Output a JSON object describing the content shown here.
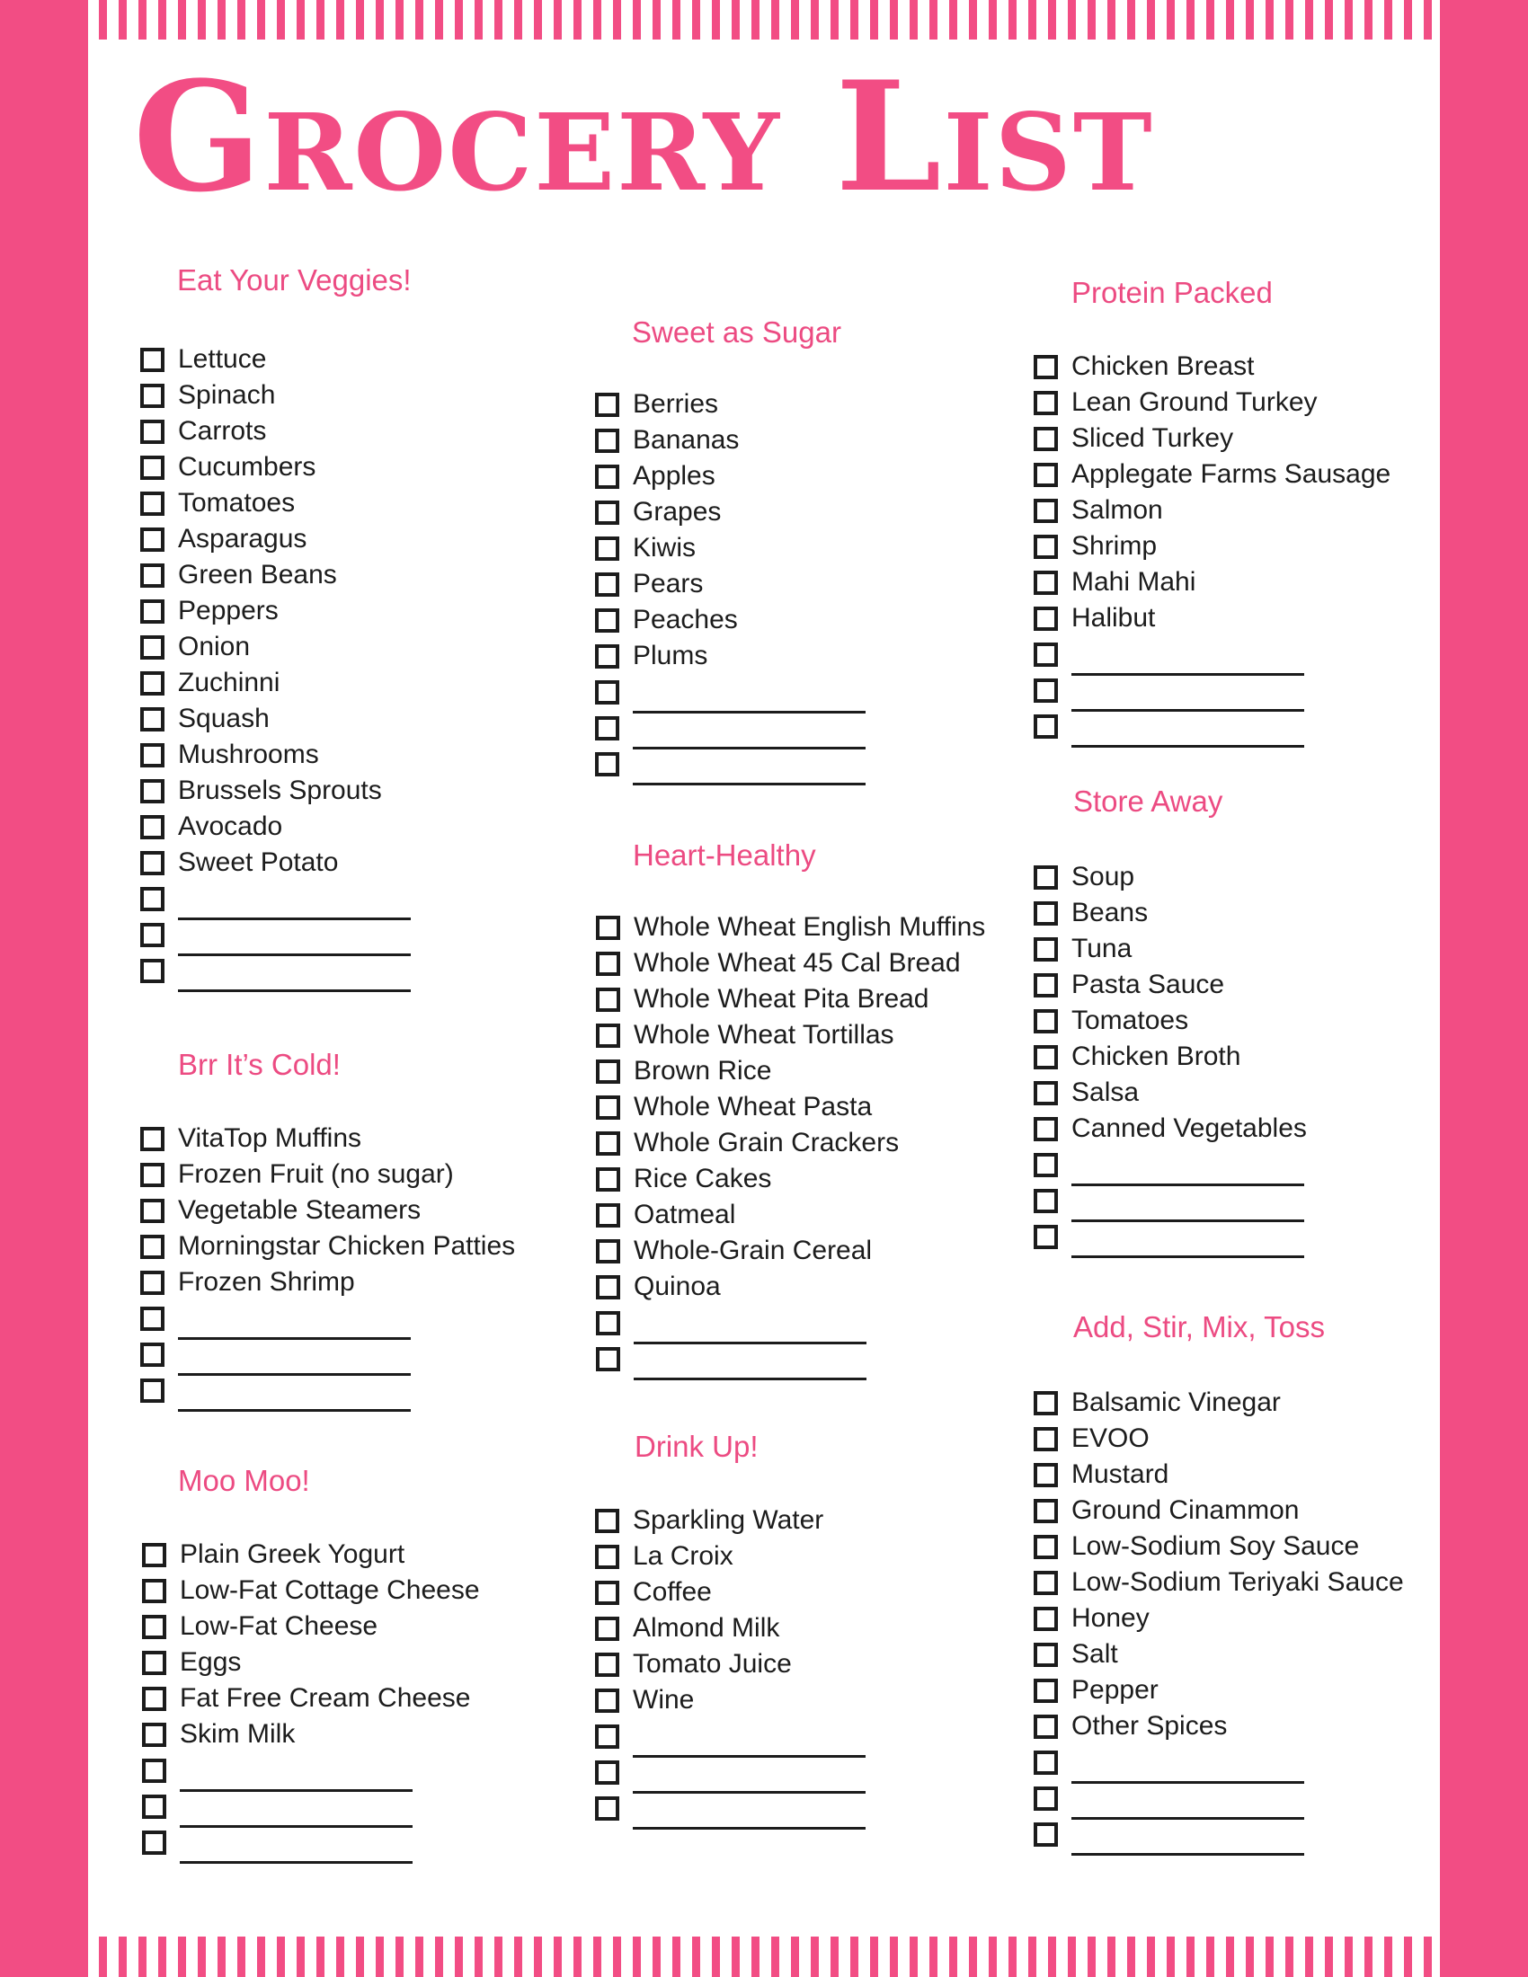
{
  "title": "Grocery List",
  "colors": {
    "accent": "#f24d84",
    "heading": "#ec4b82",
    "text": "#1c1c1c"
  },
  "sections": {
    "veggies": {
      "title": "Eat Your Veggies!",
      "items": [
        "Lettuce",
        "Spinach",
        "Carrots",
        "Cucumbers",
        "Tomatoes",
        "Asparagus",
        "Green Beans",
        "Peppers",
        "Onion",
        "Zuchinni",
        "Squash",
        "Mushrooms",
        "Brussels Sprouts",
        "Avocado",
        "Sweet Potato"
      ],
      "blank_count": 3
    },
    "cold": {
      "title": "Brr It’s Cold!",
      "items": [
        "VitaTop Muffins",
        "Frozen Fruit (no sugar)",
        "Vegetable Steamers",
        "Morningstar Chicken Patties",
        "Frozen Shrimp"
      ],
      "blank_count": 3
    },
    "dairy": {
      "title": "Moo Moo!",
      "items": [
        "Plain Greek Yogurt",
        "Low-Fat Cottage Cheese",
        "Low-Fat Cheese",
        "Eggs",
        "Fat Free Cream Cheese",
        "Skim Milk"
      ],
      "blank_count": 3
    },
    "fruit": {
      "title": "Sweet as Sugar",
      "items": [
        "Berries",
        "Bananas",
        "Apples",
        "Grapes",
        "Kiwis",
        "Pears",
        "Peaches",
        "Plums"
      ],
      "blank_count": 3
    },
    "grains": {
      "title": "Heart-Healthy",
      "items": [
        "Whole Wheat English Muffins",
        "Whole Wheat 45 Cal Bread",
        "Whole Wheat Pita Bread",
        "Whole Wheat Tortillas",
        "Brown Rice",
        "Whole Wheat Pasta",
        "Whole Grain Crackers",
        "Rice Cakes",
        "Oatmeal",
        "Whole-Grain Cereal",
        "Quinoa"
      ],
      "blank_count": 2
    },
    "drinks": {
      "title": "Drink Up!",
      "items": [
        "Sparkling Water",
        "La Croix",
        "Coffee",
        "Almond Milk",
        "Tomato Juice",
        "Wine"
      ],
      "blank_count": 3
    },
    "protein": {
      "title": "Protein Packed",
      "items": [
        "Chicken Breast",
        "Lean Ground Turkey",
        "Sliced Turkey",
        "Applegate Farms Sausage",
        "Salmon",
        "Shrimp",
        "Mahi Mahi",
        "Halibut"
      ],
      "blank_count": 3
    },
    "pantry": {
      "title": "Store Away",
      "items": [
        "Soup",
        "Beans",
        "Tuna",
        "Pasta Sauce",
        "Tomatoes",
        "Chicken Broth",
        "Salsa",
        "Canned Vegetables"
      ],
      "blank_count": 3
    },
    "condiments": {
      "title": "Add, Stir, Mix, Toss",
      "items": [
        "Balsamic Vinegar",
        "EVOO",
        "Mustard",
        "Ground Cinammon",
        "Low-Sodium Soy Sauce",
        "Low-Sodium Teriyaki Sauce",
        "Honey",
        "Salt",
        "Pepper",
        "Other Spices"
      ],
      "blank_count": 3
    }
  }
}
